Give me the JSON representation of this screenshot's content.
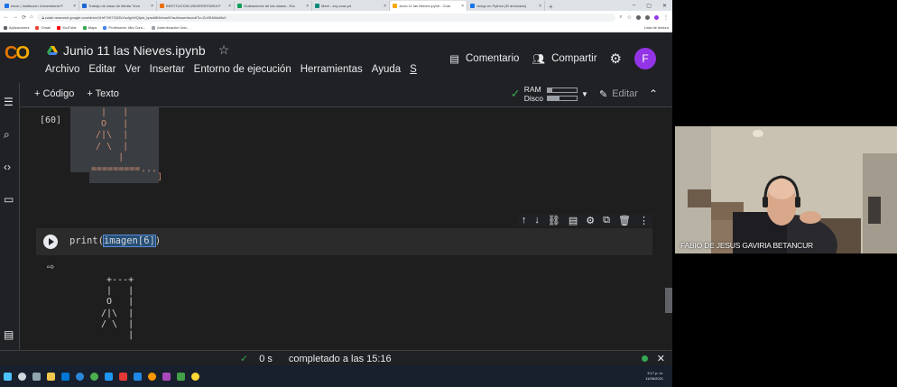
{
  "browser": {
    "tabs": [
      {
        "title": "Inicio | Institución Universitaria P",
        "color": "#1a73e8"
      },
      {
        "title": "Trabajo de clase de Media Técn",
        "color": "#1967d2"
      },
      {
        "title": "INSTITUCION UNIVERSITARIA P",
        "color": "#e8710a"
      },
      {
        "title": "Grabaciones de las clases - Exc",
        "color": "#0f9d58"
      },
      {
        "title": "Meet - zcy-xvar-yrt",
        "color": "#00897b"
      },
      {
        "title": "Junio 11 las Nieves.ipynb - Cola",
        "color": "#f9ab00",
        "active": true
      },
      {
        "title": "Juego en Python (El ahorcado)",
        "color": "#1a73e8"
      }
    ],
    "url": "colab.research.google.com/drive/1HrFOK7O0ZkYucfghHQIpkt_kpwA8HebusN?authuser#scrollTo=Zu9SAWat3sX",
    "bookmarks": [
      {
        "label": "Aplicaciones",
        "color": "#5f6368"
      },
      {
        "label": "Gmail",
        "color": "#ea4335"
      },
      {
        "label": "YouTube",
        "color": "#ff0000"
      },
      {
        "label": "Maps",
        "color": "#34a853"
      },
      {
        "label": "Profesores: Mis Curs...",
        "color": "#4285f4"
      },
      {
        "label": "Autenticación Únic...",
        "color": "#9aa0a6"
      }
    ],
    "reading_list": "Lista de lectura"
  },
  "colab": {
    "logo": "CO",
    "notebook_title": "Junio 11 las Nieves.ipynb",
    "menus": [
      "Archivo",
      "Editar",
      "Ver",
      "Insertar",
      "Entorno de ejecución",
      "Herramientas",
      "Ayuda",
      "S"
    ],
    "comment_label": "Comentario",
    "share_label": "Compartir",
    "avatar_letter": "F",
    "add_code": "+ Código",
    "add_text": "+ Texto",
    "ram_label": "RAM",
    "disk_label": "Disco",
    "ram_fraction": 0.15,
    "disk_fraction": 0.4,
    "edit_label": "Editar"
  },
  "cells": {
    "previous_output": {
      "exec_count": "[60]",
      "art_top": " |   |\n O   |\n/|\\  |\n/ \\  |",
      "art_bottom": "     |\n=========",
      "closing": "'''",
      "bracket": "]"
    },
    "code_cell": {
      "code_prefix": "print(",
      "code_selected": "imagen[6]",
      "code_suffix": ")"
    },
    "output": {
      "art": "  +---+\n  |   |\n  O   |\n /|\\  |\n / \\  |\n      |"
    }
  },
  "status": {
    "duration": "0 s",
    "completed": "completado a las 15:16"
  },
  "taskbar": {
    "time": "3:17 p. m.",
    "date": "11/06/2021"
  },
  "video": {
    "participant_name": "FABIO DE JESUS GAVIRIA BETANCUR"
  }
}
